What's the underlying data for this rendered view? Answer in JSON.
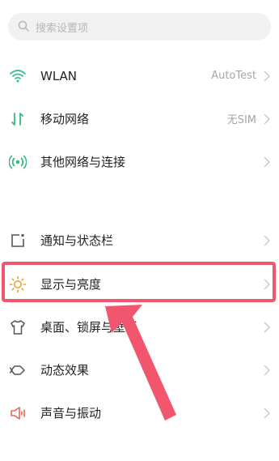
{
  "search": {
    "placeholder": "搜索设置项"
  },
  "rows": {
    "wlan": {
      "label": "WLAN",
      "value": "AutoTest"
    },
    "mobile": {
      "label": "移动网络",
      "value": "无SIM"
    },
    "other": {
      "label": "其他网络与连接"
    },
    "notifications": {
      "label": "通知与状态栏"
    },
    "display": {
      "label": "显示与亮度"
    },
    "desktop": {
      "label": "桌面、锁屏与壁纸"
    },
    "motion": {
      "label": "动态效果"
    },
    "sound": {
      "label": "声音与振动"
    }
  },
  "icons": {
    "search": "search-icon",
    "wlan": "wifi-icon",
    "mobile": "mobile-data-icon",
    "other": "wireless-connection-icon",
    "notifications": "notification-bar-icon",
    "display": "brightness-sun-icon",
    "desktop": "shirt-theme-icon",
    "motion": "animation-effect-icon",
    "sound": "speaker-icon",
    "chevron": "chevron-right-icon"
  },
  "colors": {
    "wifi": "#3cbf8c",
    "mobile": "#39b97f",
    "other": "#39b97f",
    "notifications": "#555555",
    "display": "#e8a33a",
    "desktop": "#555555",
    "motion": "#555555",
    "sound": "#e8675a",
    "annotation": "#f2566e"
  }
}
